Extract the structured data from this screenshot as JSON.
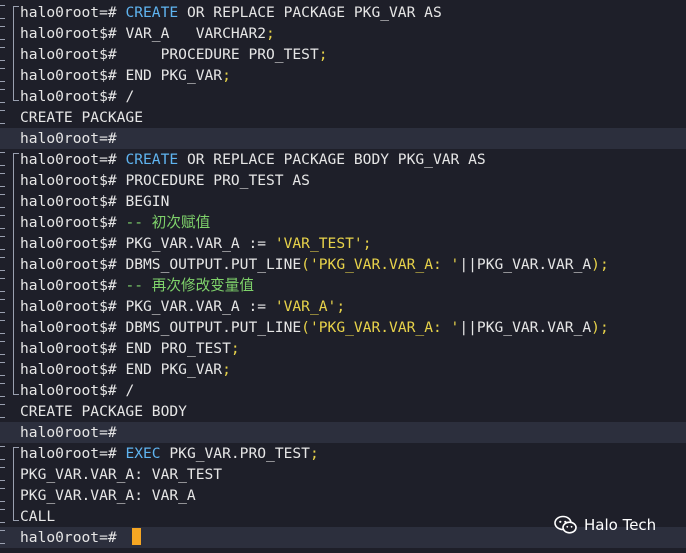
{
  "terminal": {
    "lines": [
      {
        "gutter": true,
        "tree": "start",
        "hl": false,
        "tokens": [
          {
            "c": "prompt",
            "t": "halo0root=# "
          },
          {
            "c": "kw-blue",
            "t": "CREATE"
          },
          {
            "c": "kw",
            "t": " OR REPLACE PACKAGE PKG_VAR AS"
          }
        ]
      },
      {
        "gutter": true,
        "tree": "mid",
        "hl": false,
        "tokens": [
          {
            "c": "prompt",
            "t": "halo0root$# "
          },
          {
            "c": "ident",
            "t": "VAR_A   VARCHAR2"
          },
          {
            "c": "punct",
            "t": ";"
          }
        ]
      },
      {
        "gutter": true,
        "tree": "mid",
        "hl": false,
        "tokens": [
          {
            "c": "prompt",
            "t": "halo0root$# "
          },
          {
            "c": "ident",
            "t": "    PROCEDURE PRO_TEST"
          },
          {
            "c": "punct",
            "t": ";"
          }
        ]
      },
      {
        "gutter": true,
        "tree": "mid",
        "hl": false,
        "tokens": [
          {
            "c": "prompt",
            "t": "halo0root$# "
          },
          {
            "c": "ident",
            "t": "END PKG_VAR"
          },
          {
            "c": "punct",
            "t": ";"
          }
        ]
      },
      {
        "gutter": true,
        "tree": "end",
        "hl": false,
        "tokens": [
          {
            "c": "prompt",
            "t": "halo0root$# "
          },
          {
            "c": "ident",
            "t": "/"
          }
        ]
      },
      {
        "gutter": true,
        "tree": "none",
        "hl": false,
        "tokens": [
          {
            "c": "output",
            "t": "CREATE PACKAGE"
          }
        ]
      },
      {
        "gutter": false,
        "tree": "none",
        "hl": true,
        "tokens": [
          {
            "c": "prompt",
            "t": "halo0root=# "
          }
        ]
      },
      {
        "gutter": true,
        "tree": "start",
        "hl": false,
        "tokens": [
          {
            "c": "prompt",
            "t": "halo0root=# "
          },
          {
            "c": "kw-blue",
            "t": "CREATE"
          },
          {
            "c": "kw",
            "t": " OR REPLACE PACKAGE BODY PKG_VAR AS"
          }
        ]
      },
      {
        "gutter": true,
        "tree": "mid",
        "hl": false,
        "tokens": [
          {
            "c": "prompt",
            "t": "halo0root$# "
          },
          {
            "c": "ident",
            "t": "PROCEDURE PRO_TEST AS"
          }
        ]
      },
      {
        "gutter": true,
        "tree": "mid",
        "hl": false,
        "tokens": [
          {
            "c": "prompt",
            "t": "halo0root$# "
          },
          {
            "c": "ident",
            "t": "BEGIN"
          }
        ]
      },
      {
        "gutter": true,
        "tree": "mid",
        "hl": false,
        "tokens": [
          {
            "c": "prompt",
            "t": "halo0root$# "
          },
          {
            "c": "comment",
            "t": "-- 初次赋值"
          }
        ]
      },
      {
        "gutter": true,
        "tree": "mid",
        "hl": false,
        "tokens": [
          {
            "c": "prompt",
            "t": "halo0root$# "
          },
          {
            "c": "ident",
            "t": "PKG_VAR.VAR_A := "
          },
          {
            "c": "string",
            "t": "'VAR_TEST'"
          },
          {
            "c": "punct",
            "t": ";"
          }
        ]
      },
      {
        "gutter": true,
        "tree": "mid",
        "hl": false,
        "tokens": [
          {
            "c": "prompt",
            "t": "halo0root$# "
          },
          {
            "c": "ident",
            "t": "DBMS_OUTPUT.PUT_LINE"
          },
          {
            "c": "punct",
            "t": "("
          },
          {
            "c": "string",
            "t": "'PKG_VAR.VAR_A: '"
          },
          {
            "c": "op",
            "t": "||"
          },
          {
            "c": "ident",
            "t": "PKG_VAR.VAR_A"
          },
          {
            "c": "punct",
            "t": ");"
          }
        ]
      },
      {
        "gutter": true,
        "tree": "mid",
        "hl": false,
        "tokens": [
          {
            "c": "prompt",
            "t": "halo0root$# "
          },
          {
            "c": "comment",
            "t": "-- 再次修改变量值"
          }
        ]
      },
      {
        "gutter": true,
        "tree": "mid",
        "hl": false,
        "tokens": [
          {
            "c": "prompt",
            "t": "halo0root$# "
          },
          {
            "c": "ident",
            "t": "PKG_VAR.VAR_A := "
          },
          {
            "c": "string",
            "t": "'VAR_A'"
          },
          {
            "c": "punct",
            "t": ";"
          }
        ]
      },
      {
        "gutter": true,
        "tree": "mid",
        "hl": false,
        "tokens": [
          {
            "c": "prompt",
            "t": "halo0root$# "
          },
          {
            "c": "ident",
            "t": "DBMS_OUTPUT.PUT_LINE"
          },
          {
            "c": "punct",
            "t": "("
          },
          {
            "c": "string",
            "t": "'PKG_VAR.VAR_A: '"
          },
          {
            "c": "op",
            "t": "||"
          },
          {
            "c": "ident",
            "t": "PKG_VAR.VAR_A"
          },
          {
            "c": "punct",
            "t": ");"
          }
        ]
      },
      {
        "gutter": true,
        "tree": "mid",
        "hl": false,
        "tokens": [
          {
            "c": "prompt",
            "t": "halo0root$# "
          },
          {
            "c": "ident",
            "t": "END PRO_TEST"
          },
          {
            "c": "punct",
            "t": ";"
          }
        ]
      },
      {
        "gutter": true,
        "tree": "mid",
        "hl": false,
        "tokens": [
          {
            "c": "prompt",
            "t": "halo0root$# "
          },
          {
            "c": "ident",
            "t": "END PKG_VAR"
          },
          {
            "c": "punct",
            "t": ";"
          }
        ]
      },
      {
        "gutter": true,
        "tree": "end",
        "hl": false,
        "tokens": [
          {
            "c": "prompt",
            "t": "halo0root$# "
          },
          {
            "c": "ident",
            "t": "/"
          }
        ]
      },
      {
        "gutter": true,
        "tree": "none",
        "hl": false,
        "tokens": [
          {
            "c": "output",
            "t": "CREATE PACKAGE BODY"
          }
        ]
      },
      {
        "gutter": false,
        "tree": "none",
        "hl": true,
        "tokens": [
          {
            "c": "prompt",
            "t": "halo0root=# "
          }
        ]
      },
      {
        "gutter": true,
        "tree": "start",
        "hl": false,
        "tokens": [
          {
            "c": "prompt",
            "t": "halo0root=# "
          },
          {
            "c": "kw-blue",
            "t": "EXEC"
          },
          {
            "c": "ident",
            "t": " PKG_VAR.PRO_TEST"
          },
          {
            "c": "punct",
            "t": ";"
          }
        ]
      },
      {
        "gutter": true,
        "tree": "mid",
        "hl": false,
        "tokens": [
          {
            "c": "output",
            "t": "PKG_VAR.VAR_A: VAR_TEST"
          }
        ]
      },
      {
        "gutter": true,
        "tree": "mid",
        "hl": false,
        "tokens": [
          {
            "c": "output",
            "t": "PKG_VAR.VAR_A: VAR_A"
          }
        ]
      },
      {
        "gutter": true,
        "tree": "end",
        "hl": false,
        "tokens": [
          {
            "c": "output",
            "t": "CALL"
          }
        ]
      },
      {
        "gutter": true,
        "tree": "none",
        "hl": true,
        "cursor": true,
        "tokens": [
          {
            "c": "prompt",
            "t": "halo0root=# "
          }
        ]
      }
    ]
  },
  "watermark": {
    "icon": "wechat-icon",
    "text": "Halo Tech"
  },
  "colors": {
    "background": "#1e1f29",
    "highlight_row": "#2c2f3d",
    "keyword_blue": "#5fb4f0",
    "string_yellow": "#e8d34a",
    "comment_green": "#7fd36b",
    "cursor_orange": "#f5a623"
  }
}
